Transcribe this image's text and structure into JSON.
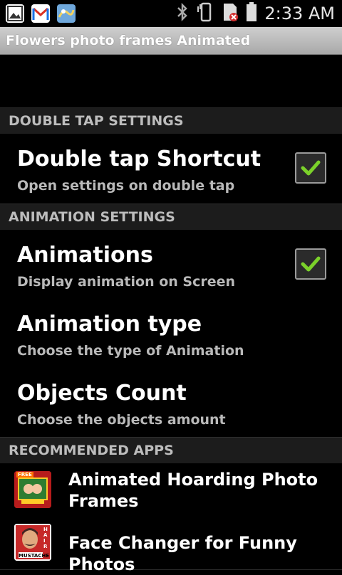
{
  "status_bar": {
    "time": "2:33 AM",
    "icons": [
      "gallery-icon",
      "gmail-icon",
      "weather-map-icon",
      "bluetooth-icon",
      "vibrate-icon",
      "no-sim-icon",
      "battery-icon"
    ]
  },
  "app_title": "Flowers photo frames Animated",
  "sections": {
    "double_tap": "DOUBLE TAP SETTINGS",
    "animation": "ANIMATION SETTINGS",
    "recommended": "RECOMMENDED APPS"
  },
  "prefs": {
    "double_tap_shortcut": {
      "title": "Double tap Shortcut",
      "summary": "Open settings on double tap",
      "checked": true
    },
    "animations": {
      "title": "Animations",
      "summary": "Display animation on Screen",
      "checked": true
    },
    "animation_type": {
      "title": "Animation type",
      "summary": "Choose the type of Animation"
    },
    "objects_count": {
      "title": "Objects Count",
      "summary": "Choose the objects amount"
    }
  },
  "recommended_apps": [
    {
      "name": "Animated Hoarding Photo Frames",
      "icon_badge": "FREE"
    },
    {
      "name": "Face Changer for Funny Photos",
      "icon_caption": "MUSTACHE",
      "icon_side": "HAIR"
    }
  ],
  "colors": {
    "background": "#000000",
    "section_bg": "#1c1c1c",
    "check_green": "#7bd12a"
  }
}
